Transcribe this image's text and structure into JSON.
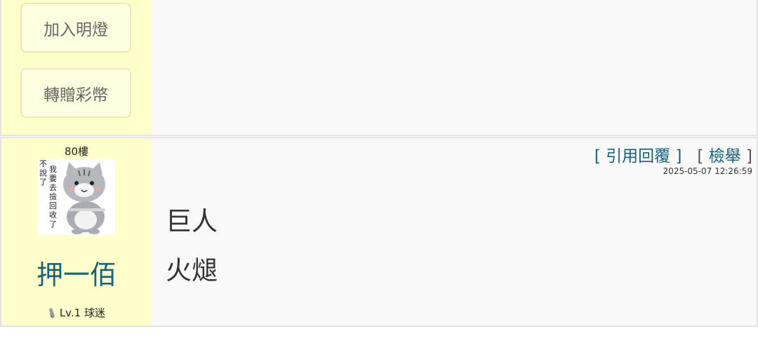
{
  "post1": {
    "buttons": [
      "加入明燈",
      "轉贈彩幣"
    ]
  },
  "post2": {
    "floor": "80樓",
    "avatar_text": "我要去撿回收了 不說了",
    "username": "押一佰",
    "level": "Lv.1 球迷",
    "actions": {
      "quote_label": "引用回覆",
      "report_label": "檢舉"
    },
    "timestamp": "2025-05-07 12:26:59",
    "content_lines": [
      "巨人",
      "火煺"
    ]
  },
  "colors": {
    "sidebar_bg": "#ffffcc",
    "link": "#17617a",
    "content_bg": "#f9f9f9"
  }
}
